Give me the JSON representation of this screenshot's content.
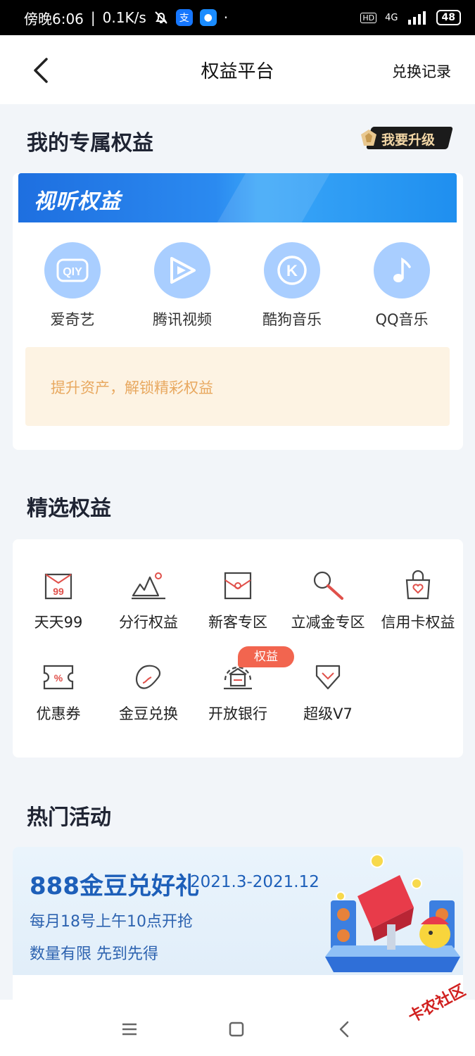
{
  "status_bar": {
    "time": "傍晚6:06",
    "speed": "0.1K/s",
    "network": "4G",
    "hd": "HD",
    "battery": "48"
  },
  "header": {
    "back_icon": "chevron-left-icon",
    "title": "权益平台",
    "record_link": "兑换记录"
  },
  "exclusive": {
    "title": "我的专属权益",
    "upgrade_label": "我要升级",
    "banner_title": "视听权益",
    "services": [
      {
        "name": "爱奇艺",
        "icon": "iqiyi-icon",
        "glyph": "QIY"
      },
      {
        "name": "腾讯视频",
        "icon": "tencent-video-icon"
      },
      {
        "name": "酷狗音乐",
        "icon": "kugou-icon",
        "glyph": "K"
      },
      {
        "name": "QQ音乐",
        "icon": "qq-music-icon"
      }
    ],
    "notice": "提升资产，解锁精彩权益"
  },
  "selected": {
    "title": "精选权益",
    "items": [
      {
        "name": "天天99",
        "icon": "bag-99-icon",
        "glyph": "99"
      },
      {
        "name": "分行权益",
        "icon": "mountain-icon"
      },
      {
        "name": "新客专区",
        "icon": "envelope-icon"
      },
      {
        "name": "立减金专区",
        "icon": "magnifier-icon"
      },
      {
        "name": "信用卡权益",
        "icon": "shopping-bag-icon"
      },
      {
        "name": "优惠券",
        "icon": "coupon-icon",
        "glyph": "%"
      },
      {
        "name": "金豆兑换",
        "icon": "bean-icon"
      },
      {
        "name": "开放银行",
        "icon": "open-bank-icon"
      },
      {
        "name": "超级V7",
        "icon": "diamond-icon"
      }
    ],
    "tag": "权益"
  },
  "hot": {
    "title": "热门活动",
    "promo_title": "888金豆兑好礼",
    "promo_dates": "2021.3-2021.12",
    "promo_line1": "每月18号上午10点开抢",
    "promo_line2": "数量有限 先到先得"
  },
  "watermark": "卡农社区",
  "colors": {
    "accent_blue": "#2b8af0",
    "icon_circle": "#a9ceff",
    "notice_bg": "#fdf3e3",
    "notice_text": "#e8a85f",
    "tag_red": "#f2654f",
    "icon_red": "#e0504a"
  }
}
